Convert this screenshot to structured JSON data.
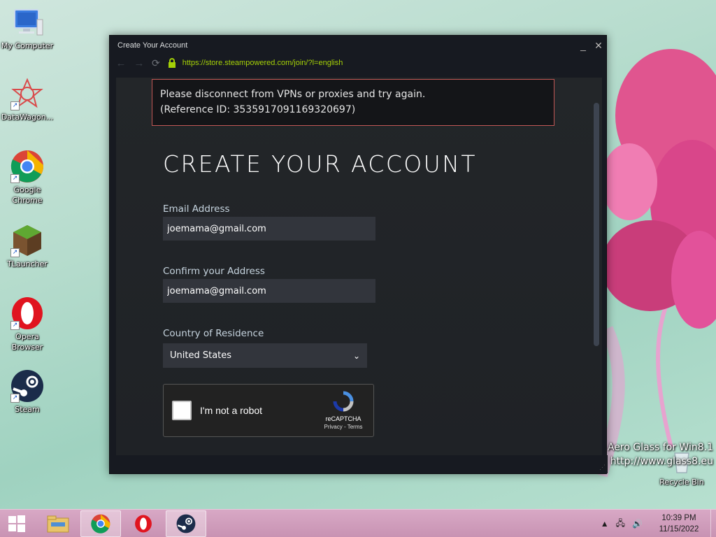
{
  "desktop": {
    "icons": [
      {
        "label": "My Computer",
        "icon": "computer-icon"
      },
      {
        "label": "DataWagon...",
        "icon": "datawagon-icon"
      },
      {
        "label": "Google Chrome",
        "icon": "chrome-icon"
      },
      {
        "label": "TLauncher",
        "icon": "tlauncher-icon"
      },
      {
        "label": "Opera Browser",
        "icon": "opera-icon"
      },
      {
        "label": "Steam",
        "icon": "steam-icon"
      },
      {
        "label": "Recycle Bin",
        "icon": "recycle-bin-icon"
      }
    ],
    "watermark": {
      "line1": "Aero Glass for Win8.1",
      "line2": "http://www.glass8.eu"
    }
  },
  "window": {
    "title": "Create Your Account",
    "minimize": "_",
    "close": "✕",
    "url": "https://store.steampowered.com/join/?l=english"
  },
  "page": {
    "error": {
      "line1": "Please disconnect from VPNs or proxies and try again.",
      "line2": "(Reference ID: 3535917091169320697)"
    },
    "heading": "CREATE YOUR ACCOUNT",
    "email": {
      "label": "Email Address",
      "value": "joemama@gmail.com"
    },
    "confirm": {
      "label": "Confirm your Address",
      "value": "joemama@gmail.com"
    },
    "country": {
      "label": "Country of Residence",
      "value": "United States"
    },
    "recaptcha": {
      "label": "I'm not a robot",
      "brand": "reCAPTCHA",
      "links": "Privacy - Terms"
    }
  },
  "taskbar": {
    "apps": [
      "file-explorer-icon",
      "chrome-icon",
      "opera-icon",
      "steam-icon"
    ],
    "clock": {
      "time": "10:39 PM",
      "date": "11/15/2022"
    }
  },
  "colors": {
    "url": "#a4d007",
    "error_border": "#c15755",
    "heading": "#ffffff"
  }
}
